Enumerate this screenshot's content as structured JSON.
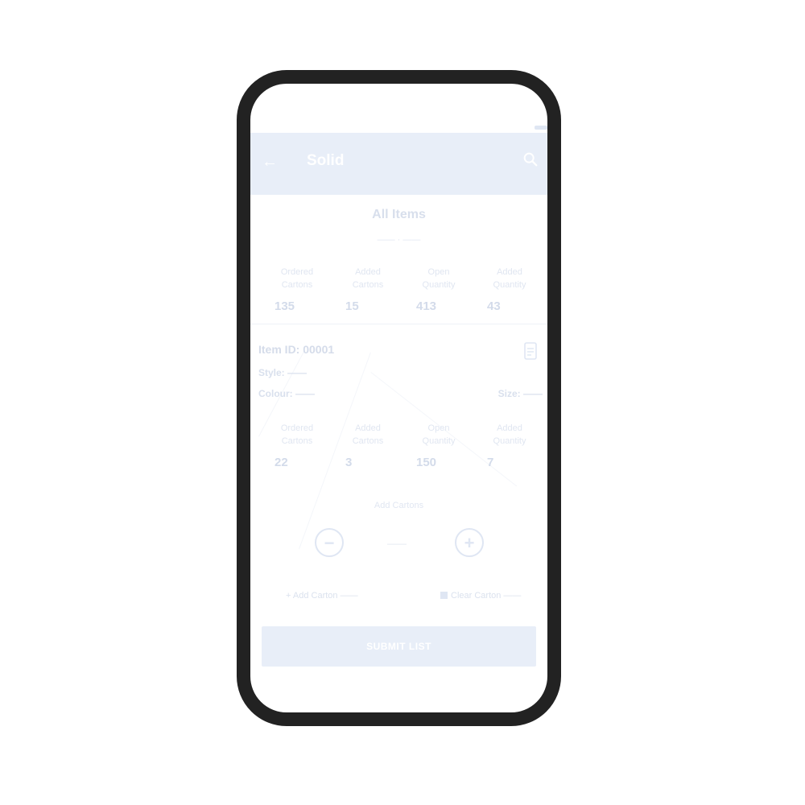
{
  "appbar": {
    "title": "Solid",
    "back_icon": "arrow-left-icon",
    "search_icon": "search-icon"
  },
  "summary": {
    "title": "All Items",
    "subtitle": "—— · ——",
    "stats": [
      {
        "label": "Ordered Cartons",
        "value": "135"
      },
      {
        "label": "Added Cartons",
        "value": "15"
      },
      {
        "label": "Open Quantity",
        "value": "413"
      },
      {
        "label": "Added Quantity",
        "value": "43"
      }
    ]
  },
  "item": {
    "id_label": "Item ID: 00001",
    "style_label": "Style: ——",
    "color_label": "Colour: ——",
    "size_label": "Size: ——",
    "stats": [
      {
        "label": "Ordered Cartons",
        "value": "22"
      },
      {
        "label": "Added Cartons",
        "value": "3"
      },
      {
        "label": "Open Quantity",
        "value": "150"
      },
      {
        "label": "Added Quantity",
        "value": "7"
      }
    ]
  },
  "quantity": {
    "label": "Add Cartons",
    "value": "——",
    "minus_symbol": "−",
    "plus_symbol": "+"
  },
  "links": {
    "left": "+ Add Carton ——",
    "right": "Clear Carton ——"
  },
  "submit": {
    "label": "SUBMIT LIST"
  }
}
